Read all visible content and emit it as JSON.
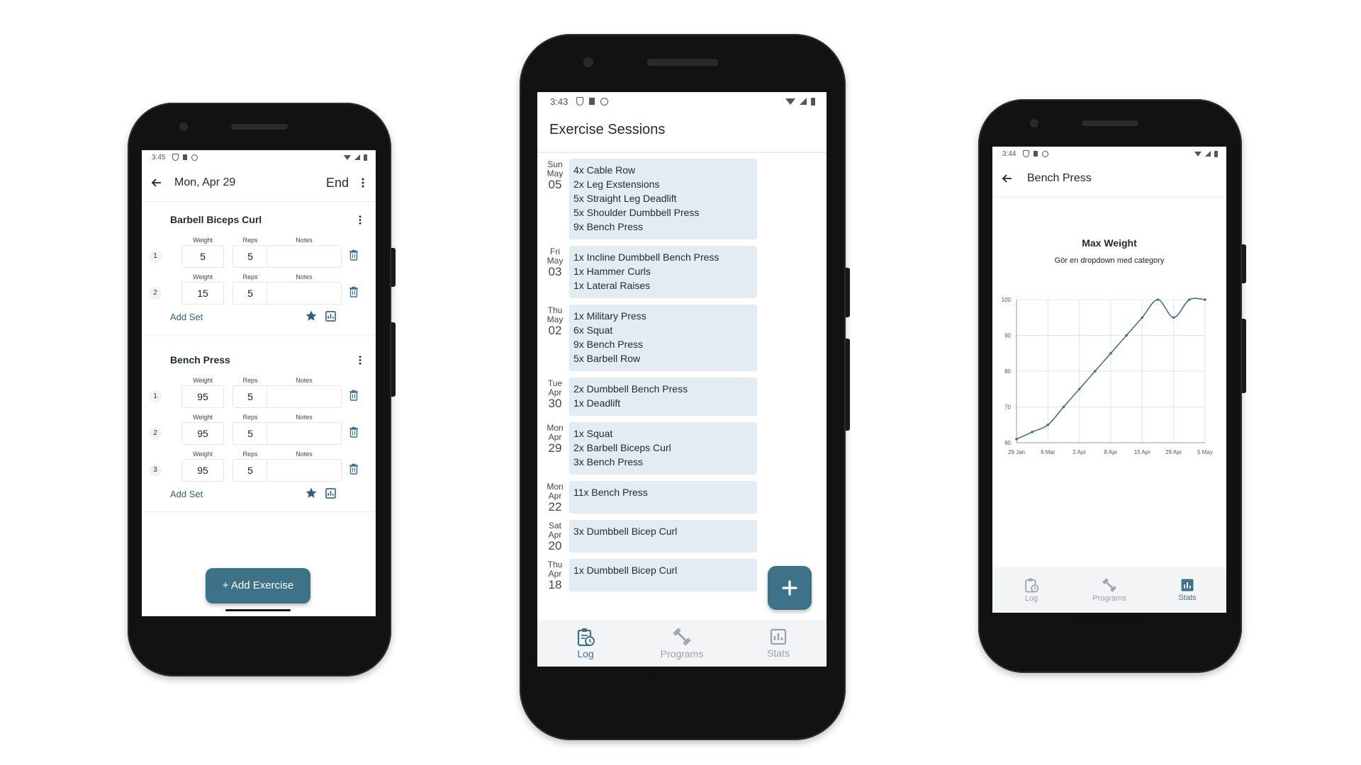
{
  "phone1": {
    "status": {
      "time": "3:45"
    },
    "appbar": {
      "date": "Mon, Apr 29",
      "end_label": "End"
    },
    "columns": {
      "weight": "Weight",
      "reps": "Reps",
      "notes": "Notes"
    },
    "exercises": [
      {
        "name": "Barbell Biceps Curl",
        "add_set": "Add Set",
        "sets": [
          {
            "idx": "1",
            "weight": "5",
            "reps": "5"
          },
          {
            "idx": "2",
            "weight": "15",
            "reps": "5"
          }
        ]
      },
      {
        "name": "Bench Press",
        "add_set": "Add Set",
        "sets": [
          {
            "idx": "1",
            "weight": "95",
            "reps": "5"
          },
          {
            "idx": "2",
            "weight": "95",
            "reps": "5"
          },
          {
            "idx": "3",
            "weight": "95",
            "reps": "5"
          }
        ]
      }
    ],
    "add_exercise": "+ Add Exercise"
  },
  "phone2": {
    "status": {
      "time": "3:43"
    },
    "title": "Exercise Sessions",
    "sessions": [
      {
        "dow": "Sun",
        "mon": "May",
        "day": "05",
        "items": [
          "4x Cable Row",
          "2x Leg Exstensions",
          "5x Straight Leg Deadlift",
          "5x Shoulder Dumbbell Press",
          "9x Bench Press"
        ]
      },
      {
        "dow": "Fri",
        "mon": "May",
        "day": "03",
        "items": [
          "1x Incline Dumbbell Bench Press",
          "1x Hammer Curls",
          "1x Lateral Raises"
        ]
      },
      {
        "dow": "Thu",
        "mon": "May",
        "day": "02",
        "items": [
          "1x Military Press",
          "6x Squat",
          "9x Bench Press",
          "5x Barbell Row"
        ]
      },
      {
        "dow": "Tue",
        "mon": "Apr",
        "day": "30",
        "items": [
          "2x Dumbbell Bench Press",
          "1x Deadlift"
        ]
      },
      {
        "dow": "Mon",
        "mon": "Apr",
        "day": "29",
        "items": [
          "1x Squat",
          "2x Barbell Biceps Curl",
          "3x Bench Press"
        ]
      },
      {
        "dow": "Mon",
        "mon": "Apr",
        "day": "22",
        "items": [
          "11x Bench Press"
        ]
      },
      {
        "dow": "Sat",
        "mon": "Apr",
        "day": "20",
        "items": [
          "3x Dumbbell Bicep Curl"
        ]
      },
      {
        "dow": "Thu",
        "mon": "Apr",
        "day": "18",
        "items": [
          "1x Dumbbell Bicep Curl"
        ]
      }
    ],
    "nav": {
      "log": "Log",
      "programs": "Programs",
      "stats": "Stats"
    },
    "fab_icon": "plus-icon"
  },
  "phone3": {
    "status": {
      "time": "3:44"
    },
    "title": "Bench Press",
    "nav": {
      "log": "Log",
      "programs": "Programs",
      "stats": "Stats"
    },
    "chart_data": {
      "type": "line",
      "title": "Max Weight",
      "subtitle": "Gör en dropdown med category",
      "xlabel": "",
      "ylabel": "",
      "ylim": [
        60,
        100
      ],
      "yticks": [
        60,
        70,
        80,
        90,
        100
      ],
      "xticks": [
        "29 Jan",
        "6 Mar",
        "2 Apr",
        "8 Apr",
        "15 Apr",
        "29 Apr",
        "5 May"
      ],
      "x": [
        0,
        0.5,
        1,
        1.5,
        2,
        2.5,
        3,
        3.5,
        4,
        4.5,
        5,
        5.5,
        6
      ],
      "y": [
        61,
        63,
        65,
        70,
        75,
        80,
        85,
        90,
        95,
        100,
        95,
        100,
        100
      ],
      "grid": true,
      "accent": "#3e7289"
    }
  },
  "colors": {
    "accent": "#3e7289",
    "card": "#e3ecf2"
  }
}
